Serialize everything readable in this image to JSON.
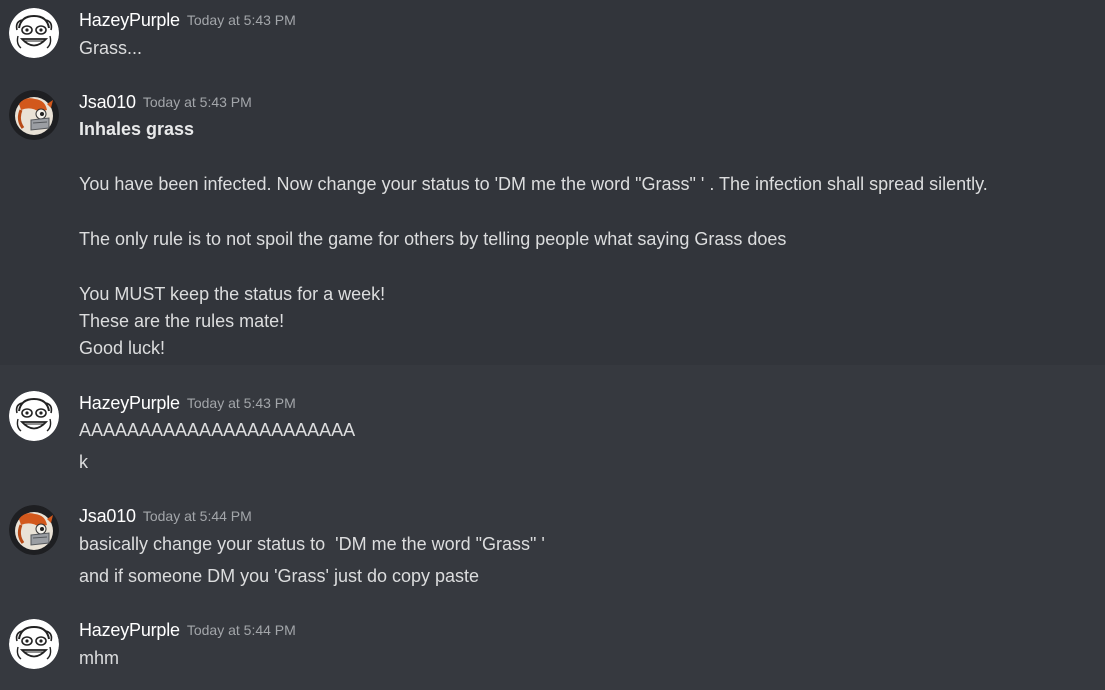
{
  "messages": [
    {
      "username": "HazeyPurple",
      "avatar": "hazey-avatar",
      "timestamp": "Today at 5:43 PM",
      "lines": [
        "Grass..."
      ]
    },
    {
      "username": "Jsa010",
      "avatar": "jsa-avatar",
      "timestamp": "Today at 5:43 PM",
      "lines": [
        "Inhales grass",
        "You have been infected. Now change your status to 'DM me the word \"Grass\" ' . The infection shall spread silently.",
        "The only rule is to not spoil the game for others by telling people what saying Grass does",
        "You MUST keep the status for a week!",
        "These are the rules mate!",
        "Good luck!"
      ]
    },
    {
      "username": "HazeyPurple",
      "avatar": "hazey-avatar",
      "timestamp": "Today at 5:43 PM",
      "lines": [
        "AAAAAAAAAAAAAAAAAAAAAAA",
        "k"
      ]
    },
    {
      "username": "Jsa010",
      "avatar": "jsa-avatar",
      "timestamp": "Today at 5:44 PM",
      "lines": [
        "basically change your status to  'DM me the word \"Grass\" '",
        "and if someone DM you 'Grass' just do copy paste"
      ]
    },
    {
      "username": "HazeyPurple",
      "avatar": "hazey-avatar",
      "timestamp": "Today at 5:44 PM",
      "lines": [
        "mhm"
      ]
    }
  ],
  "colors": {
    "background": "#36393f",
    "hover_background": "#32353b",
    "username": "#ffffff",
    "timestamp": "#a3a6aa",
    "text": "#dcddde"
  }
}
